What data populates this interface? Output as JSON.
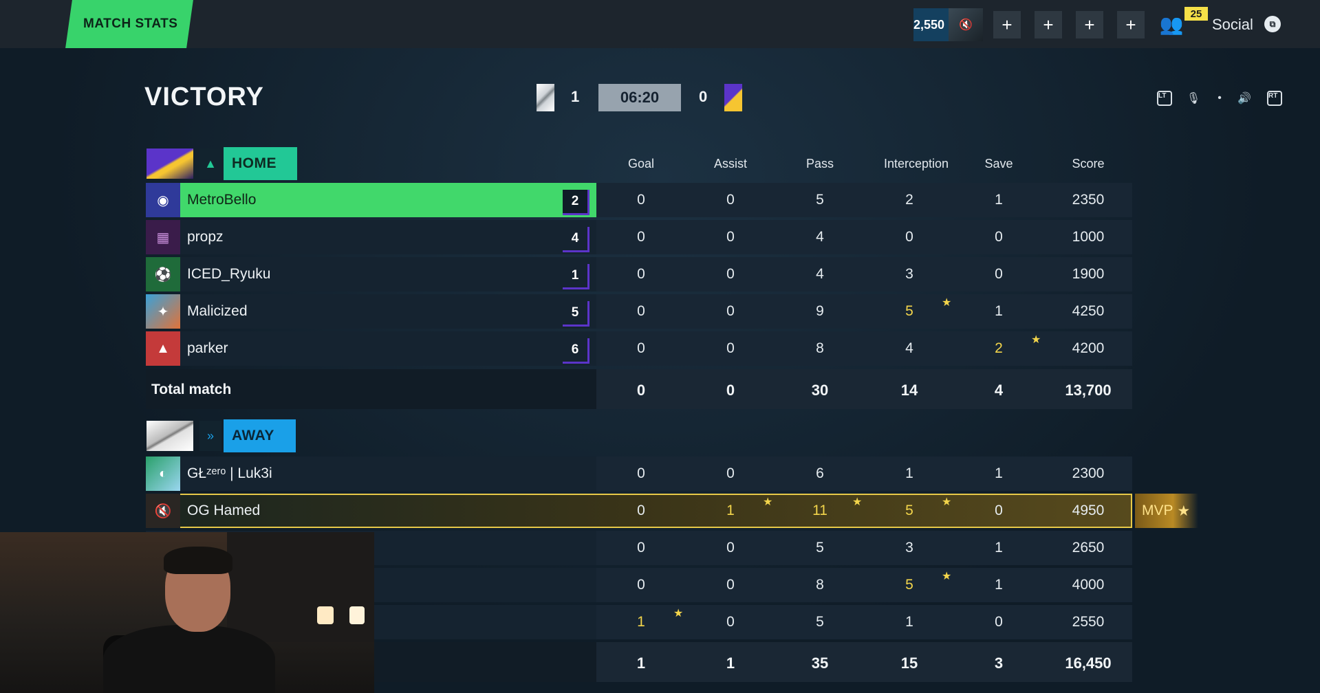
{
  "topbar": {
    "tab_label": "MATCH STATS",
    "currency": "2,550",
    "plus_label": "+",
    "friends_count": "25",
    "social_label": "Social",
    "social_key": "⧉"
  },
  "header": {
    "result": "VICTORY",
    "home_score": "1",
    "timer": "06:20",
    "away_score": "0",
    "controls": {
      "lt": "LT",
      "rt": "RT",
      "dot": "•"
    }
  },
  "columns": [
    "Goal",
    "Assist",
    "Pass",
    "Interception",
    "Save",
    "Score"
  ],
  "home": {
    "name": "HOME",
    "players": [
      {
        "name": "MetroBello",
        "pos": "2",
        "stats": [
          "0",
          "0",
          "5",
          "2",
          "1",
          "2350"
        ],
        "highlight": true
      },
      {
        "name": "propz",
        "pos": "4",
        "stats": [
          "0",
          "0",
          "4",
          "0",
          "0",
          "1000"
        ]
      },
      {
        "name": "ICED_Ryuku",
        "pos": "1",
        "stats": [
          "0",
          "0",
          "4",
          "3",
          "0",
          "1900"
        ]
      },
      {
        "name": "Malicized",
        "pos": "5",
        "stats": [
          "0",
          "0",
          "9",
          "5",
          "1",
          "4250"
        ]
      },
      {
        "name": "parker",
        "pos": "6",
        "stats": [
          "0",
          "0",
          "8",
          "4",
          "2",
          "4200"
        ]
      }
    ],
    "total_label": "Total match",
    "totals": [
      "0",
      "0",
      "30",
      "14",
      "4",
      "13,700"
    ]
  },
  "away": {
    "name": "AWAY",
    "players": [
      {
        "name": "GŁᶻᵉʳᵒ | Luk3i",
        "stats": [
          "0",
          "0",
          "6",
          "1",
          "1",
          "2300"
        ]
      },
      {
        "name": "OG Hamed",
        "stats": [
          "0",
          "1",
          "11",
          "5",
          "0",
          "4950"
        ],
        "mvp": true
      },
      {
        "name": "",
        "stats": [
          "0",
          "0",
          "5",
          "3",
          "1",
          "2650"
        ]
      },
      {
        "name": "",
        "stats": [
          "0",
          "0",
          "8",
          "5",
          "1",
          "4000"
        ]
      },
      {
        "name": "",
        "stats": [
          "1",
          "0",
          "5",
          "1",
          "0",
          "2550"
        ]
      }
    ],
    "totals": [
      "1",
      "1",
      "35",
      "15",
      "3",
      "16,450"
    ]
  },
  "mvp_label": "MVP",
  "star": "★",
  "colors": {
    "accent_green": "#41d86b",
    "home": "#22c896",
    "away": "#1aa0e8",
    "gold": "#f3d54b"
  }
}
